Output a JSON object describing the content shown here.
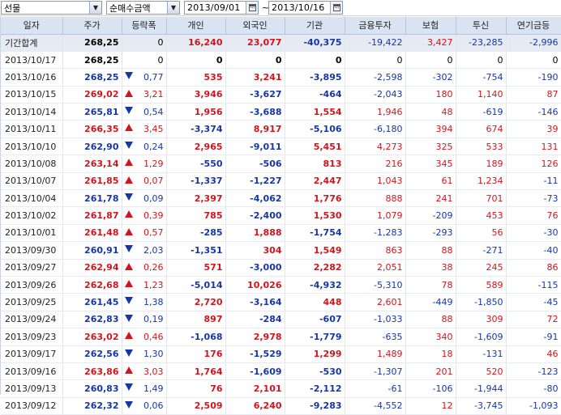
{
  "toolbar": {
    "market": "선물",
    "metric": "순매수금액",
    "date_from": "2013/09/01",
    "date_to": "2013/10/16",
    "tilde": "~"
  },
  "columns": [
    "일자",
    "주가",
    "등락폭",
    "개인",
    "외국인",
    "기관",
    "금융투자",
    "보험",
    "투신",
    "연기금등"
  ],
  "colors": {
    "up": "#d4141c",
    "down": "#1536a8",
    "header_bg": "#d9e4f3",
    "summary_bg": "#e6eaf2"
  },
  "rows": [
    {
      "date": "기간합계",
      "price": "268,25",
      "dir": "",
      "chg": "0",
      "ind": "16,240",
      "for": "23,077",
      "inst": "-40,375",
      "fin": "-19,422",
      "ins": "3,427",
      "inv": "-23,285",
      "pen": "-2,996",
      "summary": true
    },
    {
      "date": "2013/10/17",
      "price": "268,25",
      "dir": "",
      "chg": "0",
      "ind": "0",
      "for": "0",
      "inst": "0",
      "fin": "0",
      "ins": "0",
      "inv": "0",
      "pen": "0"
    },
    {
      "date": "2013/10/16",
      "price": "268,25",
      "dir": "down",
      "chg": "0,77",
      "ind": "535",
      "for": "3,241",
      "inst": "-3,895",
      "fin": "-2,598",
      "ins": "-302",
      "inv": "-754",
      "pen": "-190"
    },
    {
      "date": "2013/10/15",
      "price": "269,02",
      "dir": "up",
      "chg": "3,21",
      "ind": "3,946",
      "for": "-3,627",
      "inst": "-464",
      "fin": "-2,043",
      "ins": "180",
      "inv": "1,140",
      "pen": "87"
    },
    {
      "date": "2013/10/14",
      "price": "265,81",
      "dir": "down",
      "chg": "0,54",
      "ind": "1,956",
      "for": "-3,688",
      "inst": "1,554",
      "fin": "1,946",
      "ins": "48",
      "inv": "-619",
      "pen": "-146"
    },
    {
      "date": "2013/10/11",
      "price": "266,35",
      "dir": "up",
      "chg": "3,45",
      "ind": "-3,374",
      "for": "8,917",
      "inst": "-5,106",
      "fin": "-6,180",
      "ins": "394",
      "inv": "674",
      "pen": "39"
    },
    {
      "date": "2013/10/10",
      "price": "262,90",
      "dir": "down",
      "chg": "0,24",
      "ind": "2,965",
      "for": "-9,011",
      "inst": "5,451",
      "fin": "4,273",
      "ins": "325",
      "inv": "533",
      "pen": "131"
    },
    {
      "date": "2013/10/08",
      "price": "263,14",
      "dir": "up",
      "chg": "1,29",
      "ind": "-550",
      "for": "-506",
      "inst": "813",
      "fin": "216",
      "ins": "345",
      "inv": "189",
      "pen": "126"
    },
    {
      "date": "2013/10/07",
      "price": "261,85",
      "dir": "up",
      "chg": "0,07",
      "ind": "-1,337",
      "for": "-1,227",
      "inst": "2,447",
      "fin": "1,043",
      "ins": "61",
      "inv": "1,234",
      "pen": "-11"
    },
    {
      "date": "2013/10/04",
      "price": "261,78",
      "dir": "down",
      "chg": "0,09",
      "ind": "2,397",
      "for": "-4,062",
      "inst": "1,776",
      "fin": "888",
      "ins": "241",
      "inv": "701",
      "pen": "-73"
    },
    {
      "date": "2013/10/02",
      "price": "261,87",
      "dir": "up",
      "chg": "0,39",
      "ind": "785",
      "for": "-2,400",
      "inst": "1,530",
      "fin": "1,079",
      "ins": "-209",
      "inv": "453",
      "pen": "76"
    },
    {
      "date": "2013/10/01",
      "price": "261,48",
      "dir": "up",
      "chg": "0,57",
      "ind": "-285",
      "for": "1,888",
      "inst": "-1,754",
      "fin": "-1,283",
      "ins": "-293",
      "inv": "56",
      "pen": "-30"
    },
    {
      "date": "2013/09/30",
      "price": "260,91",
      "dir": "down",
      "chg": "2,03",
      "ind": "-1,351",
      "for": "304",
      "inst": "1,549",
      "fin": "863",
      "ins": "88",
      "inv": "-271",
      "pen": "-40"
    },
    {
      "date": "2013/09/27",
      "price": "262,94",
      "dir": "up",
      "chg": "0,26",
      "ind": "571",
      "for": "-3,000",
      "inst": "2,282",
      "fin": "2,051",
      "ins": "38",
      "inv": "245",
      "pen": "86"
    },
    {
      "date": "2013/09/26",
      "price": "262,68",
      "dir": "up",
      "chg": "1,23",
      "ind": "-5,014",
      "for": "10,026",
      "inst": "-4,932",
      "fin": "-5,310",
      "ins": "78",
      "inv": "589",
      "pen": "-115"
    },
    {
      "date": "2013/09/25",
      "price": "261,45",
      "dir": "down",
      "chg": "1,38",
      "ind": "2,720",
      "for": "-3,164",
      "inst": "448",
      "fin": "2,601",
      "ins": "-449",
      "inv": "-1,850",
      "pen": "-45"
    },
    {
      "date": "2013/09/24",
      "price": "262,83",
      "dir": "down",
      "chg": "0,19",
      "ind": "897",
      "for": "-284",
      "inst": "-607",
      "fin": "-1,033",
      "ins": "88",
      "inv": "309",
      "pen": "72"
    },
    {
      "date": "2013/09/23",
      "price": "263,02",
      "dir": "up",
      "chg": "0,46",
      "ind": "-1,068",
      "for": "2,978",
      "inst": "-1,779",
      "fin": "-635",
      "ins": "340",
      "inv": "-1,609",
      "pen": "-91"
    },
    {
      "date": "2013/09/17",
      "price": "262,56",
      "dir": "down",
      "chg": "1,30",
      "ind": "176",
      "for": "-1,529",
      "inst": "1,299",
      "fin": "1,489",
      "ins": "18",
      "inv": "-131",
      "pen": "46"
    },
    {
      "date": "2013/09/16",
      "price": "263,86",
      "dir": "up",
      "chg": "3,03",
      "ind": "1,764",
      "for": "-1,609",
      "inst": "-530",
      "fin": "-1,307",
      "ins": "201",
      "inv": "520",
      "pen": "-123"
    },
    {
      "date": "2013/09/13",
      "price": "260,83",
      "dir": "down",
      "chg": "1,49",
      "ind": "76",
      "for": "2,101",
      "inst": "-2,112",
      "fin": "-61",
      "ins": "-106",
      "inv": "-1,944",
      "pen": "-80"
    },
    {
      "date": "2013/09/12",
      "price": "262,32",
      "dir": "down",
      "chg": "0,06",
      "ind": "2,509",
      "for": "6,240",
      "inst": "-9,283",
      "fin": "-4,552",
      "ins": "12",
      "inv": "-3,745",
      "pen": "-1,093"
    }
  ]
}
